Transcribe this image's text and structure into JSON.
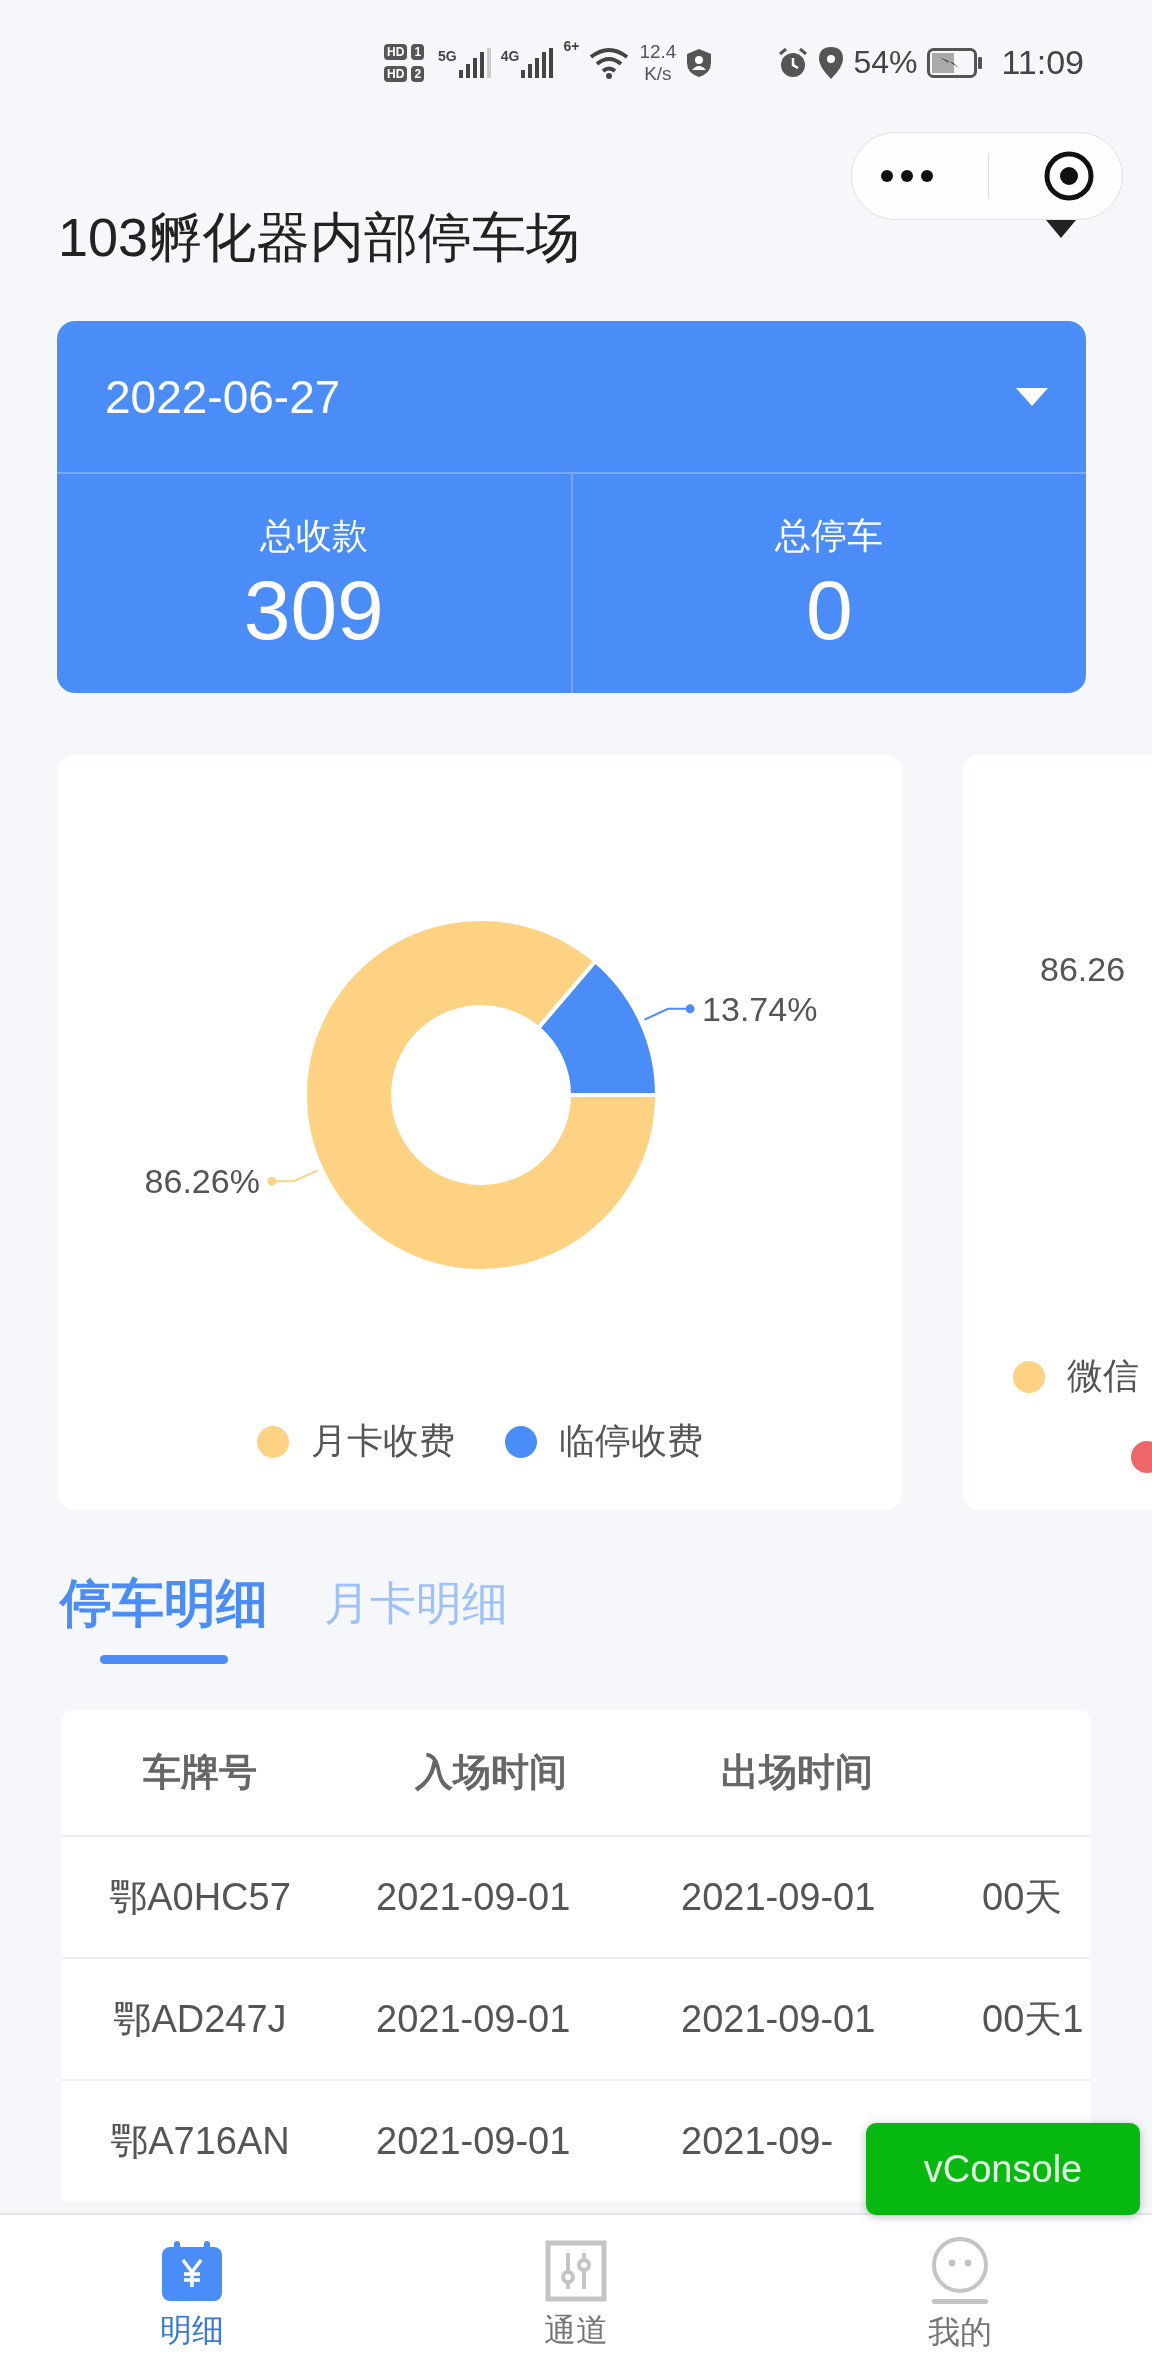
{
  "status_bar": {
    "sim_badges": [
      {
        "hd": "HD",
        "slot": "1"
      },
      {
        "hd": "HD",
        "slot": "2"
      }
    ],
    "networks": [
      "5G",
      "4G"
    ],
    "wifi_label": "6+",
    "speed": [
      "12.4",
      "K/s"
    ],
    "battery": "54%",
    "time": "11:09"
  },
  "header": {
    "title": "103孵化器内部停车场"
  },
  "summary": {
    "date": "2022-06-27",
    "stats": [
      {
        "label": "总收款",
        "value": "309"
      },
      {
        "label": "总停车",
        "value": "0"
      }
    ]
  },
  "charts": [
    {
      "chart_data": {
        "type": "donut",
        "categories": [
          "月卡收费",
          "临停收费"
        ],
        "series": [
          {
            "values": [
              86.26,
              13.74
            ]
          }
        ],
        "value_labels": [
          "86.26%",
          "13.74%"
        ]
      }
    }
  ],
  "peek_card": {
    "value_label": "86.26",
    "legend": [
      {
        "label": "微信",
        "color": "#fdd283"
      },
      {
        "color": "#ee6666"
      }
    ]
  },
  "tabs": [
    {
      "label": "停车明细",
      "selected": true
    },
    {
      "label": "月卡明细",
      "selected": false
    }
  ],
  "table": {
    "columns": [
      "车牌号",
      "入场时间",
      "出场时间"
    ],
    "rows": [
      [
        "鄂A0HC57",
        "2021-09-01",
        "2021-09-01",
        "00天"
      ],
      [
        "鄂AD247J",
        "2021-09-01",
        "2021-09-01",
        "00天1"
      ],
      [
        "鄂A716AN",
        "2021-09-01",
        "2021-09-"
      ]
    ]
  },
  "console_button": "vConsole",
  "nav": [
    {
      "label": "明细",
      "selected": true,
      "kind": "bill"
    },
    {
      "label": "通道",
      "selected": false,
      "kind": "channel"
    },
    {
      "label": "我的",
      "selected": false,
      "kind": "profile"
    }
  ]
}
